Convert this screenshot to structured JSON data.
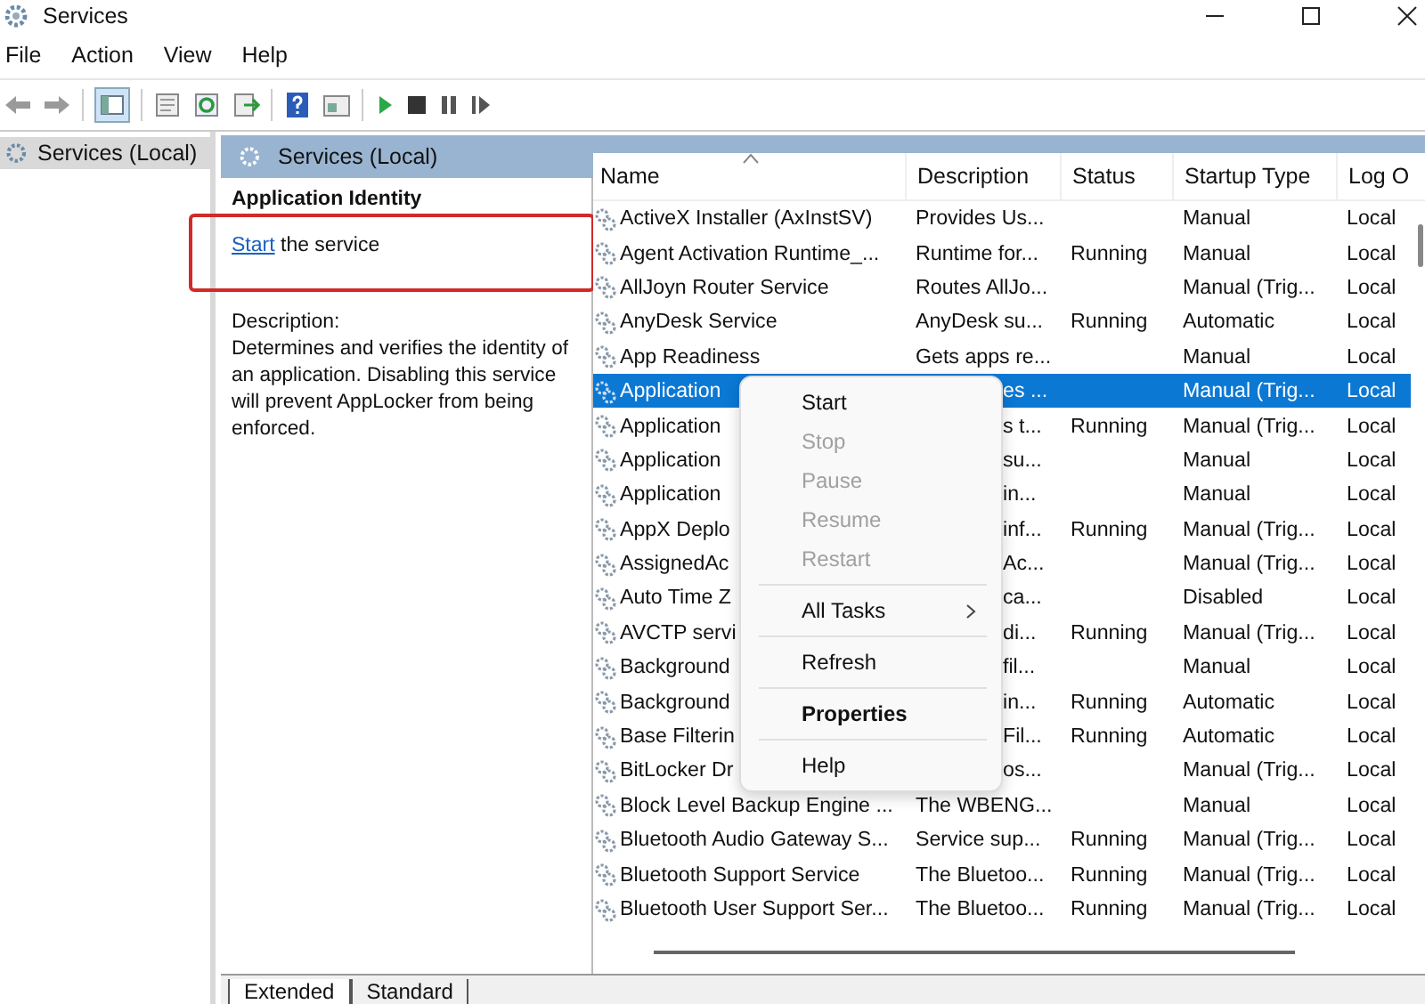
{
  "window": {
    "title": "Services"
  },
  "menu_bar": [
    "File",
    "Action",
    "View",
    "Help"
  ],
  "tree": {
    "items": [
      {
        "label": "Services (Local)",
        "selected": true
      }
    ]
  },
  "pane_header": {
    "title": "Services (Local)"
  },
  "details": {
    "title": "Application Identity",
    "action_link": "Start",
    "action_rest": "the service",
    "description_label": "Description:",
    "description": "Determines and verifies the identity of an application. Disabling this service will prevent AppLocker from being enforced."
  },
  "table": {
    "columns": [
      "Name",
      "Description",
      "Status",
      "Startup Type",
      "Log O"
    ],
    "rows": [
      {
        "name": "ActiveX Installer (AxInstSV)",
        "description": "Provides Us...",
        "status": "",
        "startup": "Manual",
        "logon": "Local",
        "selected": false
      },
      {
        "name": "Agent Activation Runtime_...",
        "description": "Runtime for...",
        "status": "Running",
        "startup": "Manual",
        "logon": "Local",
        "selected": false
      },
      {
        "name": "AllJoyn Router Service",
        "description": "Routes AllJo...",
        "status": "",
        "startup": "Manual (Trig...",
        "logon": "Local",
        "selected": false
      },
      {
        "name": "AnyDesk Service",
        "description": "AnyDesk su...",
        "status": "Running",
        "startup": "Automatic",
        "logon": "Local",
        "selected": false
      },
      {
        "name": "App Readiness",
        "description": "Gets apps re...",
        "status": "",
        "startup": "Manual",
        "logon": "Local",
        "selected": false
      },
      {
        "name": "Application",
        "description": "es ...",
        "status": "",
        "startup": "Manual (Trig...",
        "logon": "Local",
        "selected": true
      },
      {
        "name": "Application",
        "description": "s t...",
        "status": "Running",
        "startup": "Manual (Trig...",
        "logon": "Local",
        "selected": false
      },
      {
        "name": "Application",
        "description": "su...",
        "status": "",
        "startup": "Manual",
        "logon": "Local",
        "selected": false
      },
      {
        "name": "Application",
        "description": "in...",
        "status": "",
        "startup": "Manual",
        "logon": "Local",
        "selected": false
      },
      {
        "name": "AppX Deplo",
        "description": "inf...",
        "status": "Running",
        "startup": "Manual (Trig...",
        "logon": "Local",
        "selected": false
      },
      {
        "name": "AssignedAc",
        "description": "Ac...",
        "status": "",
        "startup": "Manual (Trig...",
        "logon": "Local",
        "selected": false
      },
      {
        "name": "Auto Time Z",
        "description": "ca...",
        "status": "",
        "startup": "Disabled",
        "logon": "Local",
        "selected": false
      },
      {
        "name": "AVCTP servi",
        "description": "di...",
        "status": "Running",
        "startup": "Manual (Trig...",
        "logon": "Local",
        "selected": false
      },
      {
        "name": "Background",
        "description": "fil...",
        "status": "",
        "startup": "Manual",
        "logon": "Local",
        "selected": false
      },
      {
        "name": "Background",
        "description": "in...",
        "status": "Running",
        "startup": "Automatic",
        "logon": "Local",
        "selected": false
      },
      {
        "name": "Base Filterin",
        "description": "Fil...",
        "status": "Running",
        "startup": "Automatic",
        "logon": "Local",
        "selected": false
      },
      {
        "name": "BitLocker Dr",
        "description": "os...",
        "status": "",
        "startup": "Manual (Trig...",
        "logon": "Local",
        "selected": false
      },
      {
        "name": "Block Level Backup Engine ...",
        "description": "The WBENG...",
        "status": "",
        "startup": "Manual",
        "logon": "Local",
        "selected": false
      },
      {
        "name": "Bluetooth Audio Gateway S...",
        "description": "Service sup...",
        "status": "Running",
        "startup": "Manual (Trig...",
        "logon": "Local",
        "selected": false
      },
      {
        "name": "Bluetooth Support Service",
        "description": "The Bluetoo...",
        "status": "Running",
        "startup": "Manual (Trig...",
        "logon": "Local",
        "selected": false
      },
      {
        "name": "Bluetooth User Support Ser...",
        "description": "The Bluetoo...",
        "status": "Running",
        "startup": "Manual (Trig...",
        "logon": "Local",
        "selected": false
      }
    ]
  },
  "context_menu": {
    "items": [
      {
        "label": "Start",
        "disabled": false,
        "bold": false,
        "submenu": false,
        "separator_before": false
      },
      {
        "label": "Stop",
        "disabled": true,
        "bold": false,
        "submenu": false,
        "separator_before": false
      },
      {
        "label": "Pause",
        "disabled": true,
        "bold": false,
        "submenu": false,
        "separator_before": false
      },
      {
        "label": "Resume",
        "disabled": true,
        "bold": false,
        "submenu": false,
        "separator_before": false
      },
      {
        "label": "Restart",
        "disabled": true,
        "bold": false,
        "submenu": false,
        "separator_before": false
      },
      {
        "label": "All Tasks",
        "disabled": false,
        "bold": false,
        "submenu": true,
        "separator_before": true
      },
      {
        "label": "Refresh",
        "disabled": false,
        "bold": false,
        "submenu": false,
        "separator_before": true
      },
      {
        "label": "Properties",
        "disabled": false,
        "bold": true,
        "submenu": false,
        "separator_before": true
      },
      {
        "label": "Help",
        "disabled": false,
        "bold": false,
        "submenu": false,
        "separator_before": true
      }
    ]
  },
  "bottom_tabs": [
    {
      "label": "Extended",
      "selected": true
    },
    {
      "label": "Standard",
      "selected": false
    }
  ]
}
